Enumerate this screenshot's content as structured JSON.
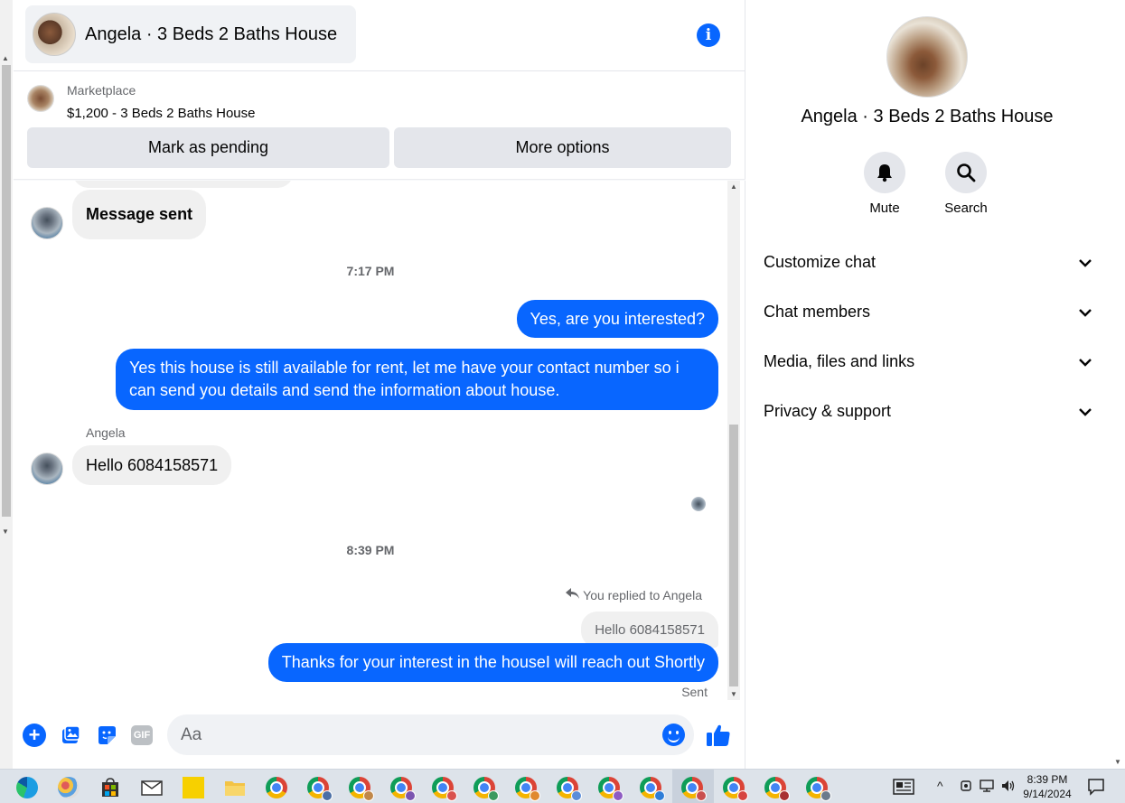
{
  "chat": {
    "title": "Angela · 3 Beds 2 Baths House",
    "marketplace_label": "Marketplace",
    "listing": "$1,200 - 3 Beds 2 Baths House",
    "buttons": {
      "pending": "Mark as pending",
      "more": "More options"
    },
    "messages": {
      "m1": "Message sent",
      "time1": "7:17 PM",
      "m2": "Yes, are you interested?",
      "m3_line1": "Yes this house is still available for rent, let me have your contact number so i",
      "m3_line2": "can send you details and send the information about house.",
      "sender": "Angela",
      "m4": "Hello 6084158571",
      "time2": "8:39 PM",
      "reply_note": "You replied to Angela",
      "quoted": "Hello 6084158571",
      "m5": "Thanks for your interest in the houseI will reach out Shortly",
      "status": "Sent"
    },
    "composer": {
      "placeholder": "Aa",
      "gif_label": "GIF"
    }
  },
  "side": {
    "title": "Angela · 3 Beds 2 Baths House",
    "actions": {
      "mute": "Mute",
      "search": "Search"
    },
    "sections": [
      "Customize chat",
      "Chat members",
      "Media, files and links",
      "Privacy & support"
    ]
  },
  "taskbar": {
    "time": "8:39 PM",
    "date": "9/14/2024"
  },
  "colors": {
    "accent": "#0866ff",
    "bubble_in": "#f0f0f0",
    "button_bg": "#e4e6eb"
  }
}
